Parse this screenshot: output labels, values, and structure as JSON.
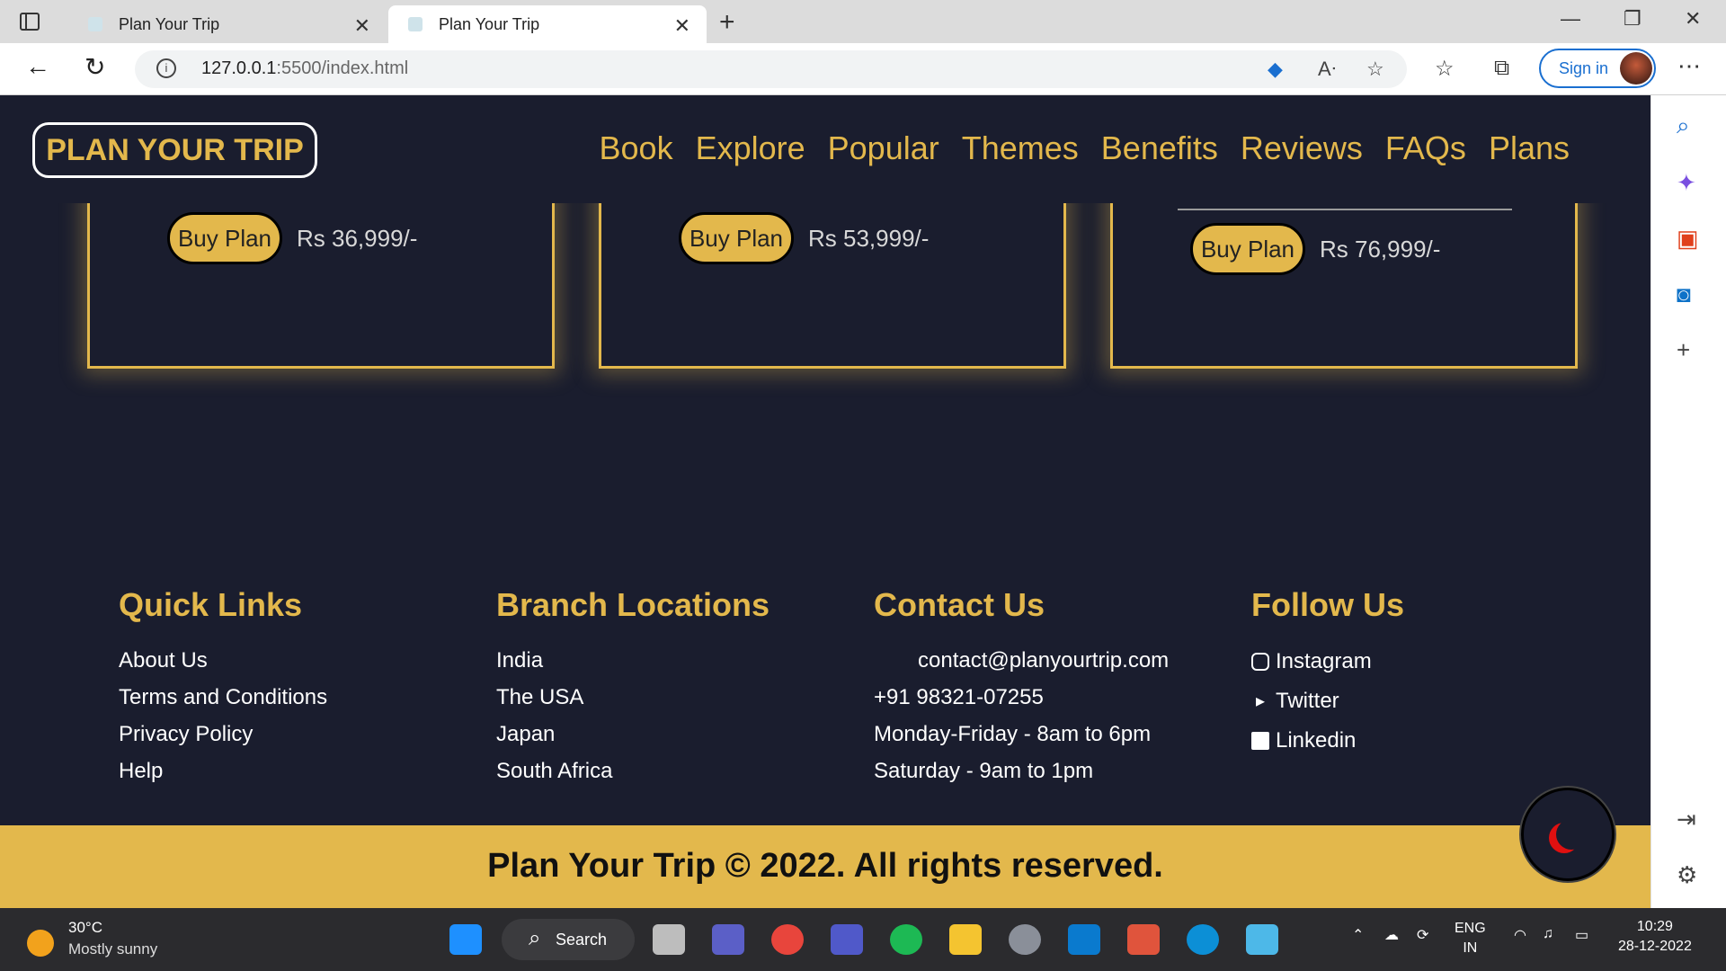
{
  "browser": {
    "tabs": [
      {
        "title": "Plan Your Trip",
        "active": false
      },
      {
        "title": "Plan Your Trip",
        "active": true
      }
    ],
    "url_host": "127.0.0.1",
    "url_path": ":5500/index.html",
    "sign_in": "Sign in"
  },
  "site": {
    "logo": "PLAN YOUR TRIP",
    "nav": [
      "Book",
      "Explore",
      "Popular",
      "Themes",
      "Benefits",
      "Reviews",
      "FAQs",
      "Plans"
    ],
    "plans": [
      {
        "button": "Buy Plan",
        "price": "Rs 36,999/-"
      },
      {
        "button": "Buy Plan",
        "price": "Rs 53,999/-"
      },
      {
        "button": "Buy Plan",
        "price": "Rs 76,999/-"
      }
    ],
    "footer": {
      "quick_links": {
        "title": "Quick Links",
        "items": [
          "About Us",
          "Terms and Conditions",
          "Privacy Policy",
          "Help"
        ]
      },
      "branches": {
        "title": "Branch Locations",
        "items": [
          "India",
          "The USA",
          "Japan",
          "South Africa"
        ]
      },
      "contact": {
        "title": "Contact Us",
        "items": [
          "contact@planyourtrip.com",
          "+91 98321-07255",
          "Monday-Friday - 8am to 6pm",
          "Saturday - 9am to 1pm"
        ]
      },
      "follow": {
        "title": "Follow Us",
        "items": [
          "Instagram",
          "Twitter",
          "Linkedin"
        ]
      },
      "copyright": "Plan Your Trip © 2022. All rights reserved."
    }
  },
  "taskbar": {
    "temp": "30°C",
    "weather": "Mostly sunny",
    "search": "Search",
    "lang1": "ENG",
    "lang2": "IN",
    "time": "10:29",
    "date": "28-12-2022"
  },
  "colors": {
    "accent": "#e3b84c",
    "bg": "#1a1d2e"
  }
}
